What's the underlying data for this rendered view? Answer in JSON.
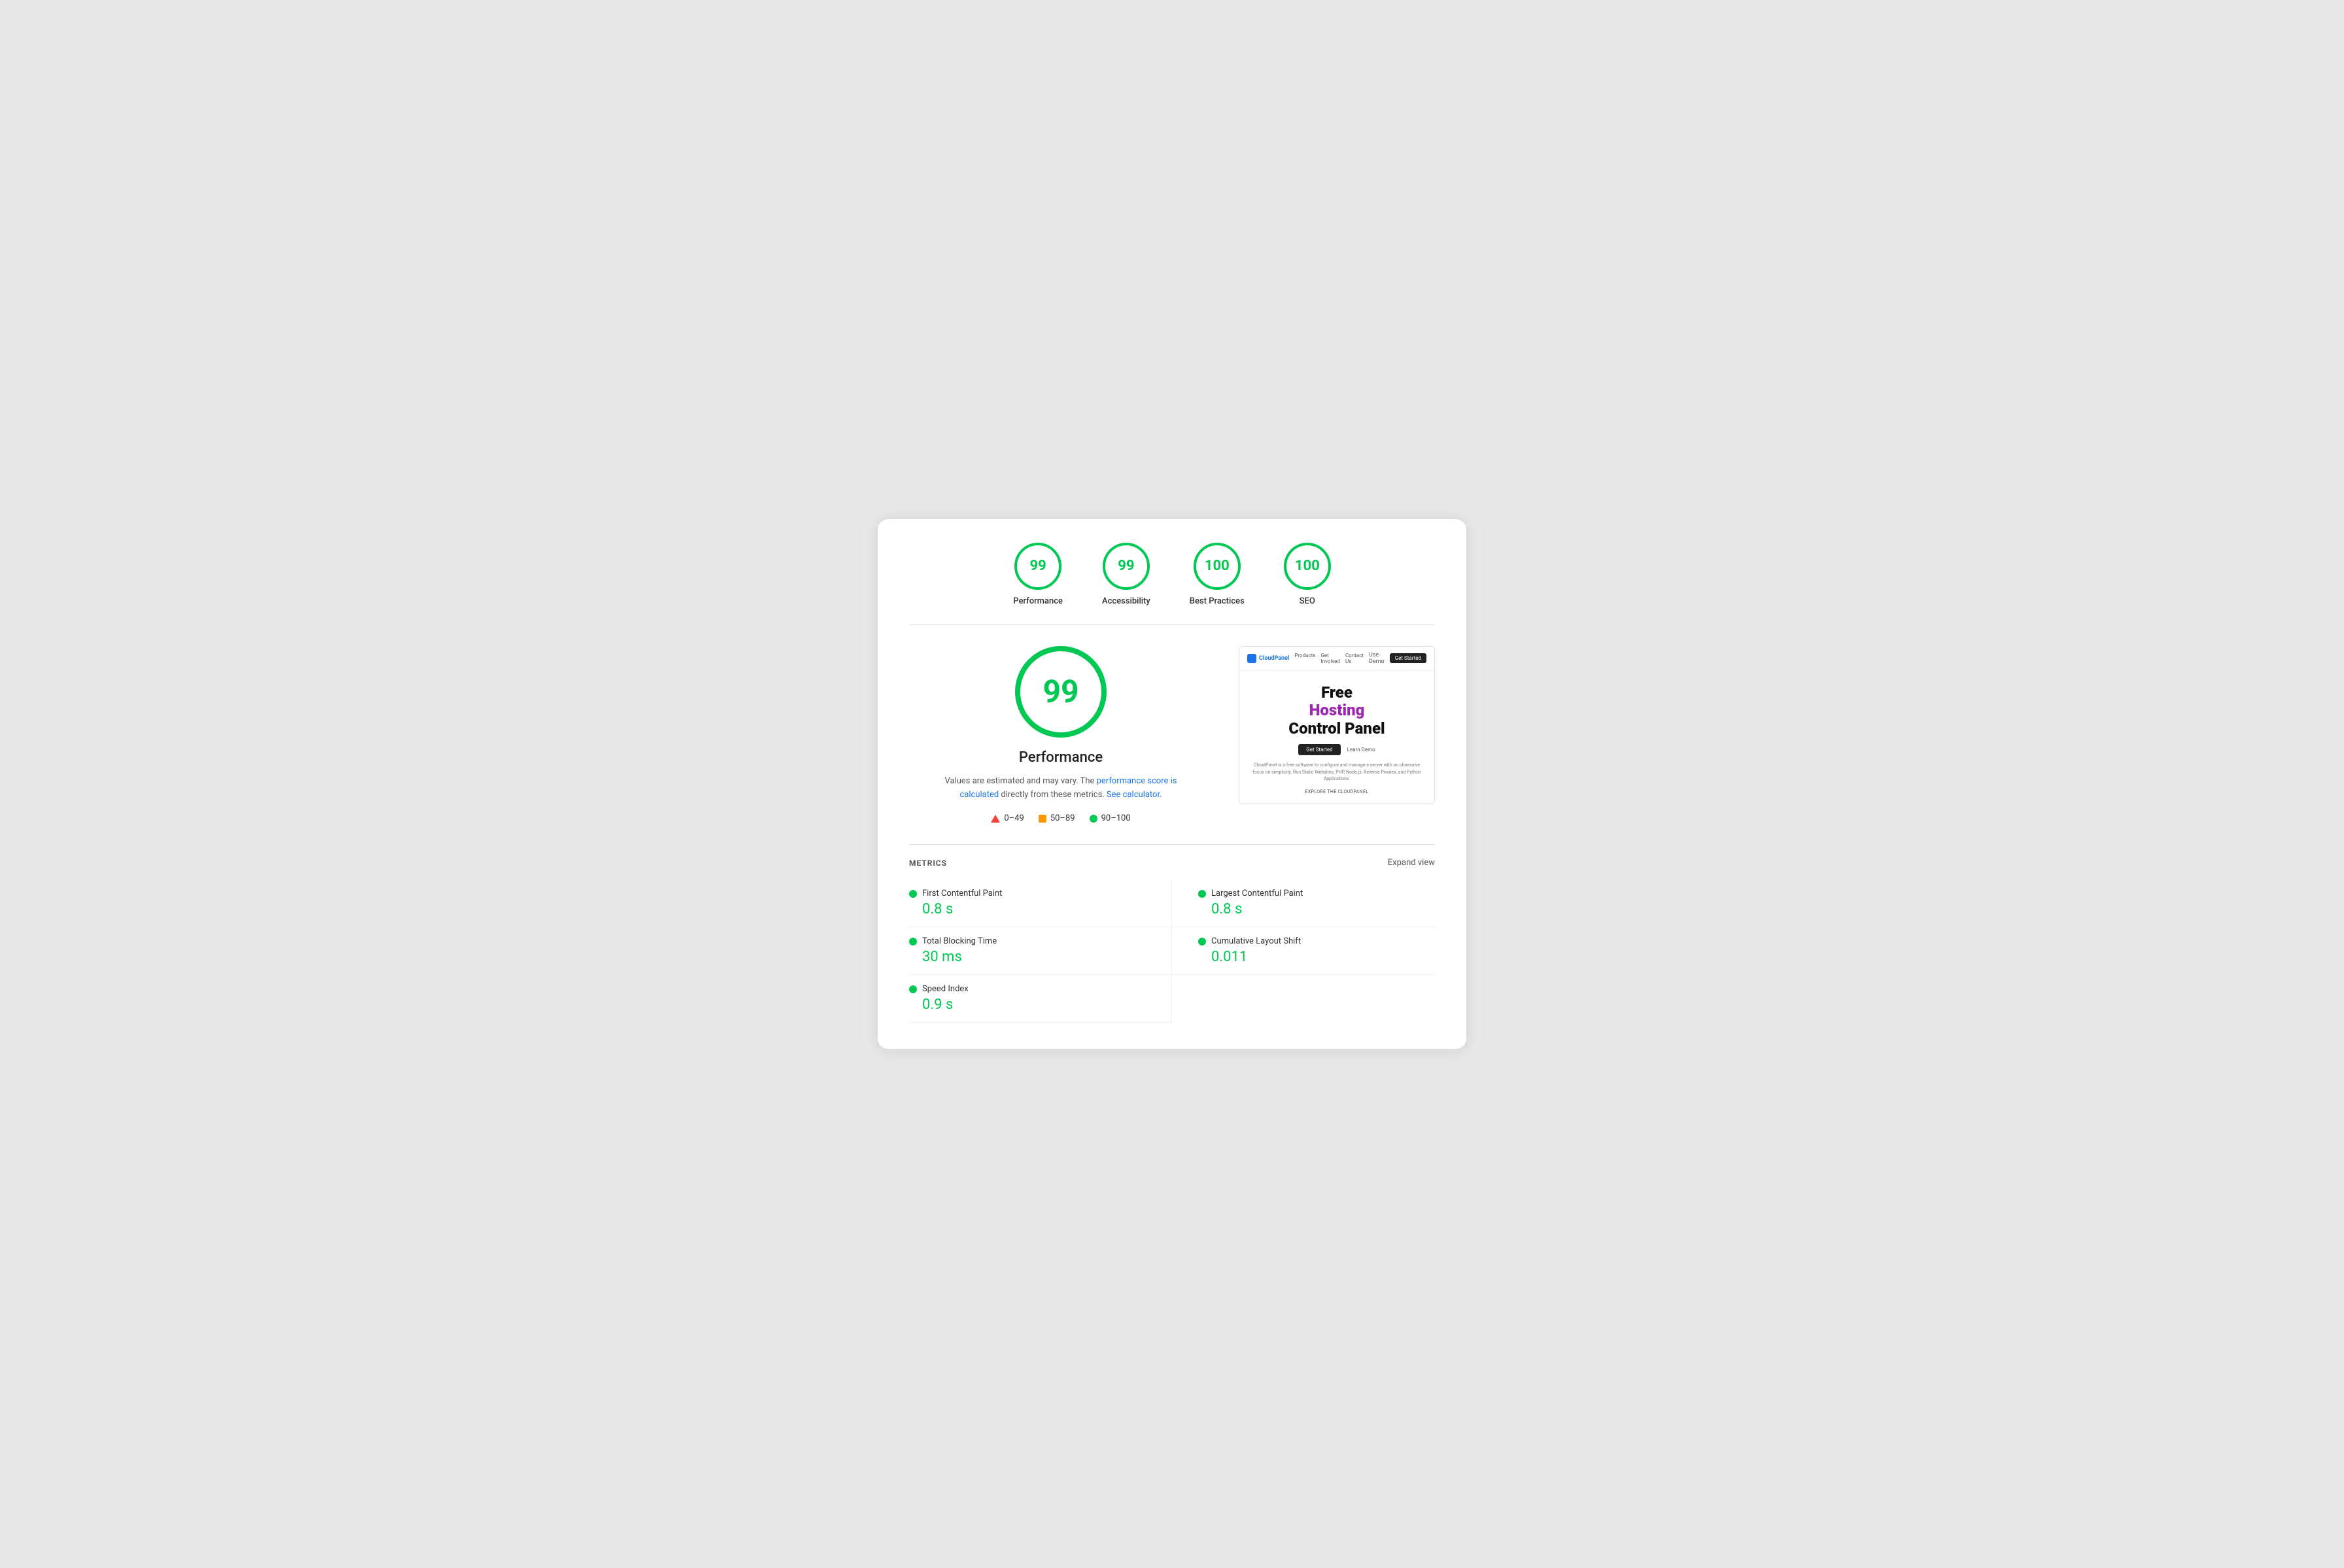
{
  "scores": [
    {
      "id": "performance",
      "value": "99",
      "label": "Performance"
    },
    {
      "id": "accessibility",
      "value": "99",
      "label": "Accessibility"
    },
    {
      "id": "best-practices",
      "value": "100",
      "label": "Best Practices"
    },
    {
      "id": "seo",
      "value": "100",
      "label": "SEO"
    }
  ],
  "main": {
    "big_score": "99",
    "section_title": "Performance",
    "description_prefix": "Values are estimated and may vary. The ",
    "description_link1": "performance score is calculated",
    "description_middle": " directly from these metrics. ",
    "description_link2": "See calculator.",
    "legend": [
      {
        "type": "triangle",
        "range": "0–49"
      },
      {
        "type": "square",
        "range": "50–89"
      },
      {
        "type": "circle",
        "range": "90–100"
      }
    ]
  },
  "preview": {
    "logo": "CloudPanel",
    "nav_links": [
      "Products",
      "Get Involved",
      "Contact Us"
    ],
    "nav_cta": "Use Demo",
    "nav_btn": "Get Started",
    "heading_line1": "Free",
    "heading_line2": "Hosting",
    "heading_line3": "Control Panel",
    "cta_btn": "Get Started",
    "cta_link": "Learn Demo",
    "desc": "CloudPanel is a free software to configure and manage a server with an obsessive focus on simplicity. Run Static Websites, PHP, Node.js, Reverse Proxies, and Python Applications.",
    "explore": "EXPLORE THE CLOUDPANEL"
  },
  "metrics": {
    "title": "METRICS",
    "expand_label": "Expand view",
    "items": [
      {
        "label": "First Contentful Paint",
        "value": "0.8 s",
        "color": "#00c853"
      },
      {
        "label": "Largest Contentful Paint",
        "value": "0.8 s",
        "color": "#00c853"
      },
      {
        "label": "Total Blocking Time",
        "value": "30 ms",
        "color": "#00c853"
      },
      {
        "label": "Cumulative Layout Shift",
        "value": "0.011",
        "color": "#00c853"
      },
      {
        "label": "Speed Index",
        "value": "0.9 s",
        "color": "#00c853"
      }
    ]
  }
}
